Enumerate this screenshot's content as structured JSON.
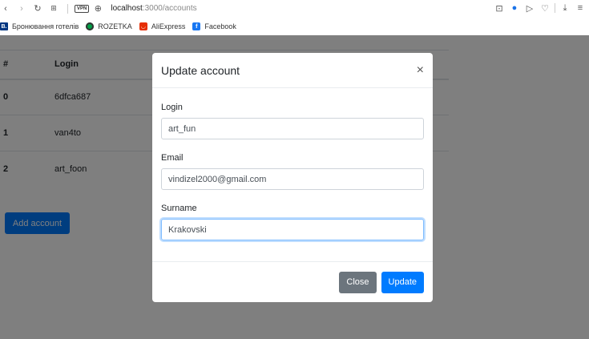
{
  "browser": {
    "url_host": "localhost",
    "url_path": ":3000/accounts",
    "vpn_label": "VPN",
    "bookmarks": [
      {
        "label": "Бронювання готелів",
        "icon": "booking-icon",
        "badge": "B.",
        "color": "#003580"
      },
      {
        "label": "ROZETKA",
        "icon": "rozetka-icon",
        "color": "#00a046"
      },
      {
        "label": "AliExpress",
        "icon": "aliexpress-icon",
        "color": "#e62e04"
      },
      {
        "label": "Facebook",
        "icon": "facebook-icon",
        "badge": "f",
        "color": "#1877f2"
      }
    ]
  },
  "table": {
    "headers": [
      "#",
      "Login"
    ],
    "rows": [
      {
        "index": "0",
        "login": "6dfca687"
      },
      {
        "index": "1",
        "login": "van4to"
      },
      {
        "index": "2",
        "login": "art_foon"
      }
    ]
  },
  "add_button_label": "Add account",
  "modal": {
    "title": "Update account",
    "close_glyph": "×",
    "fields": {
      "login": {
        "label": "Login",
        "value": "art_fun"
      },
      "email": {
        "label": "Email",
        "value": "vindizel2000@gmail.com"
      },
      "surname": {
        "label": "Surname",
        "value": "Krakovski"
      }
    },
    "close_label": "Close",
    "update_label": "Update"
  },
  "colors": {
    "primary": "#007bff",
    "secondary": "#6c757d",
    "backdrop": "rgba(0,0,0,0.5)"
  }
}
